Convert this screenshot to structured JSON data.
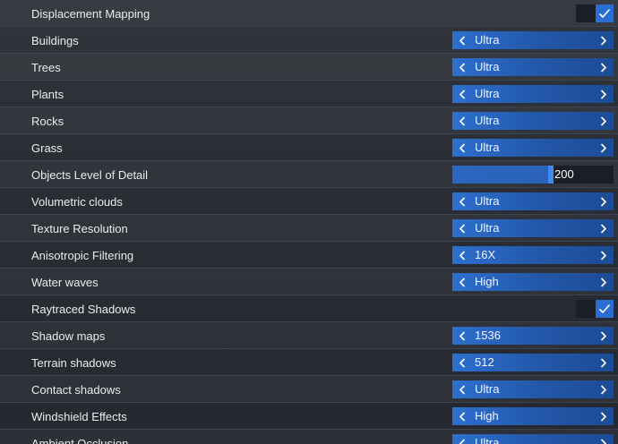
{
  "settings": [
    {
      "label": "Displacement Mapping",
      "type": "checkbox",
      "checked": true
    },
    {
      "label": "Buildings",
      "type": "selector",
      "value": "Ultra"
    },
    {
      "label": "Trees",
      "type": "selector",
      "value": "Ultra"
    },
    {
      "label": "Plants",
      "type": "selector",
      "value": "Ultra"
    },
    {
      "label": "Rocks",
      "type": "selector",
      "value": "Ultra"
    },
    {
      "label": "Grass",
      "type": "selector",
      "value": "Ultra"
    },
    {
      "label": "Objects Level of Detail",
      "type": "slider",
      "value": "200",
      "fraction": 0.62
    },
    {
      "label": "Volumetric clouds",
      "type": "selector",
      "value": "Ultra"
    },
    {
      "label": "Texture Resolution",
      "type": "selector",
      "value": "Ultra"
    },
    {
      "label": "Anisotropic Filtering",
      "type": "selector",
      "value": "16X"
    },
    {
      "label": "Water waves",
      "type": "selector",
      "value": "High"
    },
    {
      "label": "Raytraced Shadows",
      "type": "checkbox",
      "checked": true
    },
    {
      "label": "Shadow maps",
      "type": "selector",
      "value": "1536"
    },
    {
      "label": "Terrain shadows",
      "type": "selector",
      "value": "512"
    },
    {
      "label": "Contact shadows",
      "type": "selector",
      "value": "Ultra"
    },
    {
      "label": "Windshield Effects",
      "type": "selector",
      "value": "High"
    },
    {
      "label": "Ambient Occlusion",
      "type": "selector",
      "value": "Ultra"
    }
  ],
  "icons": {
    "prev": "chevron-left-icon",
    "next": "chevron-right-icon",
    "check": "checkmark-icon"
  },
  "colors": {
    "accent": "#2b6ed3",
    "selector_bg": "#2257a8",
    "track_bg": "#1a1e26"
  }
}
